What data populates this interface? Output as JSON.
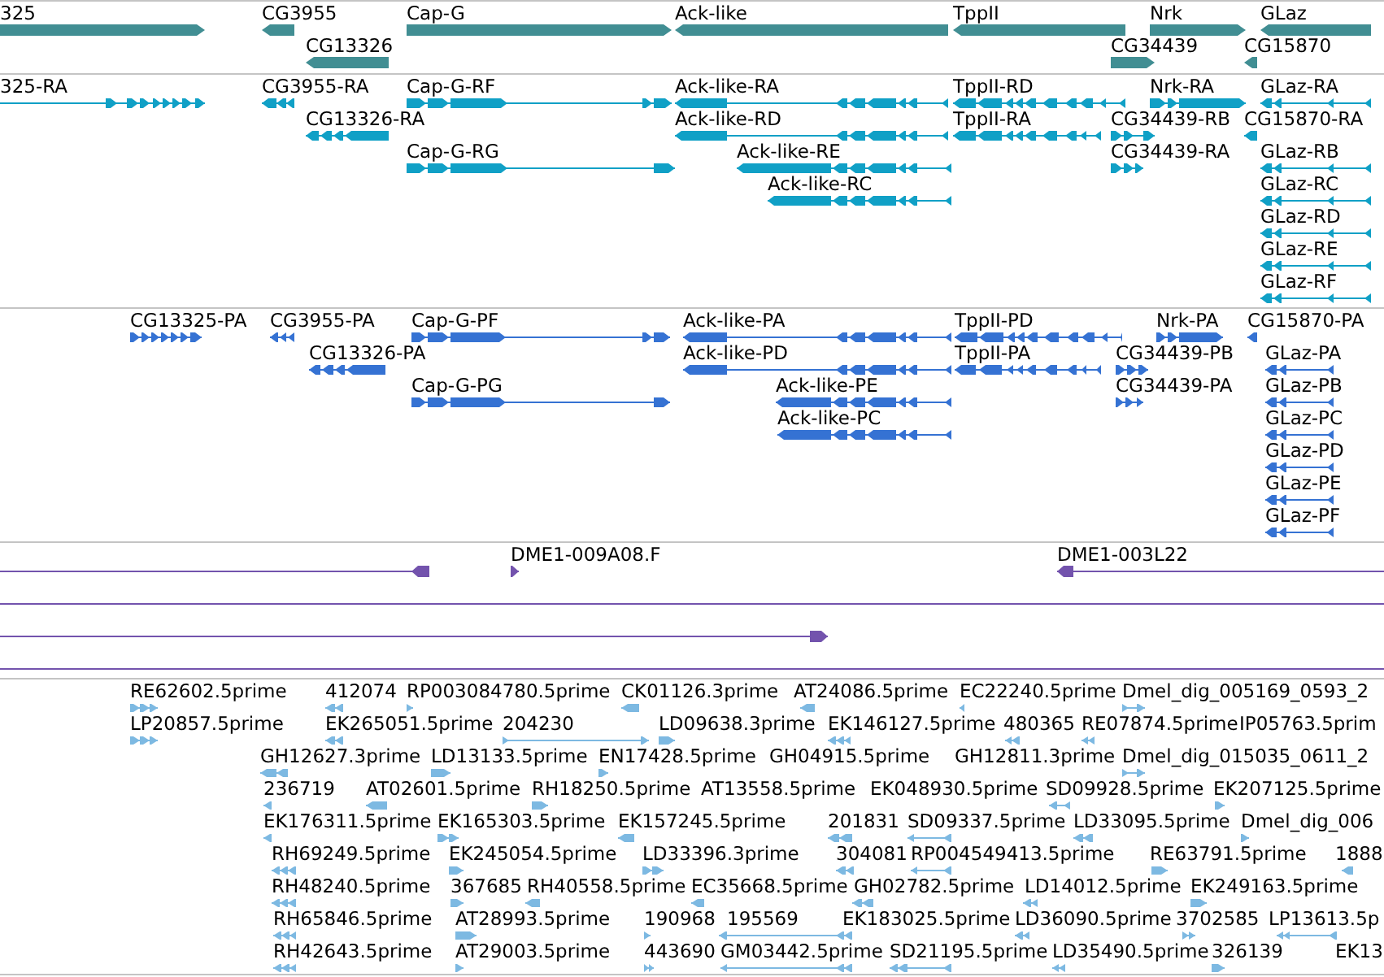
{
  "tracks": [
    {
      "kind": "gene",
      "color": "#418e93",
      "lanes": [
        {
          "features": [
            {
              "label": "325",
              "reverse": false
            },
            {
              "label": "CG3955",
              "reverse": true
            },
            {
              "label": "Cap-G",
              "reverse": false
            },
            {
              "label": "Ack-like",
              "reverse": true
            },
            {
              "label": "TppII",
              "reverse": true
            },
            {
              "label": "Nrk",
              "reverse": false
            },
            {
              "label": "GLaz",
              "reverse": true
            }
          ]
        },
        {
          "features": [
            {
              "label": "CG13326",
              "reverse": true
            },
            {
              "label": "CG34439",
              "reverse": false
            },
            {
              "label": "CG15870",
              "reverse": true
            }
          ]
        }
      ]
    },
    {
      "kind": "transcript",
      "color": "#10a0c6",
      "lanes": [
        {
          "features": [
            {
              "label": "325-RA",
              "reverse": false
            },
            {
              "label": "CG3955-RA",
              "reverse": true
            },
            {
              "label": "Cap-G-RF",
              "reverse": false
            },
            {
              "label": "Ack-like-RA",
              "reverse": true
            },
            {
              "label": "TppII-RD",
              "reverse": true
            },
            {
              "label": "Nrk-RA",
              "reverse": false
            },
            {
              "label": "GLaz-RA",
              "reverse": true
            }
          ]
        },
        {
          "features": [
            {
              "label": "CG13326-RA",
              "reverse": true
            },
            {
              "label": "Ack-like-RD",
              "reverse": true
            },
            {
              "label": "TppII-RA",
              "reverse": true
            },
            {
              "label": "CG34439-RB",
              "reverse": false
            },
            {
              "label": "CG15870-RA",
              "reverse": true
            }
          ]
        },
        {
          "features": [
            {
              "label": "Cap-G-RG",
              "reverse": false
            },
            {
              "label": "Ack-like-RE",
              "reverse": true
            },
            {
              "label": "CG34439-RA",
              "reverse": false
            },
            {
              "label": "GLaz-RB",
              "reverse": true
            }
          ]
        },
        {
          "features": [
            {
              "label": "Ack-like-RC",
              "reverse": true
            },
            {
              "label": "GLaz-RC",
              "reverse": true
            }
          ]
        },
        {
          "features": [
            {
              "label": "GLaz-RD",
              "reverse": true
            }
          ]
        },
        {
          "features": [
            {
              "label": "GLaz-RE",
              "reverse": true
            }
          ]
        },
        {
          "features": [
            {
              "label": "GLaz-RF",
              "reverse": true
            }
          ]
        }
      ]
    },
    {
      "kind": "protein",
      "color": "#3572d3",
      "lanes": [
        {
          "features": [
            {
              "label": "CG13325-PA",
              "reverse": false
            },
            {
              "label": "CG3955-PA",
              "reverse": true
            },
            {
              "label": "Cap-G-PF",
              "reverse": false
            },
            {
              "label": "Ack-like-PA",
              "reverse": true
            },
            {
              "label": "TppII-PD",
              "reverse": true
            },
            {
              "label": "Nrk-PA",
              "reverse": false
            },
            {
              "label": "CG15870-PA",
              "reverse": true
            }
          ]
        },
        {
          "features": [
            {
              "label": "CG13326-PA",
              "reverse": true
            },
            {
              "label": "Ack-like-PD",
              "reverse": true
            },
            {
              "label": "TppII-PA",
              "reverse": true
            },
            {
              "label": "CG34439-PB",
              "reverse": false
            },
            {
              "label": "GLaz-PA",
              "reverse": true
            }
          ]
        },
        {
          "features": [
            {
              "label": "Cap-G-PG",
              "reverse": false
            },
            {
              "label": "Ack-like-PE",
              "reverse": true
            },
            {
              "label": "CG34439-PA",
              "reverse": false
            },
            {
              "label": "GLaz-PB",
              "reverse": true
            }
          ]
        },
        {
          "features": [
            {
              "label": "Ack-like-PC",
              "reverse": true
            },
            {
              "label": "GLaz-PC",
              "reverse": true
            }
          ]
        },
        {
          "features": [
            {
              "label": "GLaz-PD",
              "reverse": true
            }
          ]
        },
        {
          "features": [
            {
              "label": "GLaz-PE",
              "reverse": true
            }
          ]
        },
        {
          "features": [
            {
              "label": "GLaz-PF",
              "reverse": true
            }
          ]
        }
      ]
    },
    {
      "kind": "clone",
      "color": "#7353ad",
      "lanes": [
        {
          "features": [
            {
              "kind": "arrow",
              "reverse": true
            },
            {
              "kind": "arrow",
              "label": "DME1-009A08.F",
              "reverse": false
            },
            {
              "kind": "arrow",
              "label": "DME1-003L22",
              "reverse": true
            }
          ]
        },
        {
          "features": [
            {
              "kind": "line"
            }
          ]
        },
        {
          "features": [
            {
              "kind": "arrow",
              "reverse": false
            }
          ]
        },
        {
          "features": [
            {
              "kind": "line"
            }
          ]
        }
      ]
    },
    {
      "kind": "est",
      "color": "#7db9e2",
      "lanes": [
        {
          "features": [
            {
              "label": "RE62602.5prime",
              "reverse": false
            },
            {
              "label": "412074",
              "reverse": true
            },
            {
              "label": "RP003084780.5prime",
              "reverse": false
            },
            {
              "label": "CK01126.3prime",
              "reverse": true
            },
            {
              "label": "AT24086.5prime",
              "reverse": true
            },
            {
              "label": "EC22240.5prime",
              "reverse": true
            },
            {
              "label": "Dmel_dig_005169_0593_2",
              "reverse": false
            }
          ]
        },
        {
          "features": [
            {
              "label": "LP20857.5prime",
              "reverse": false
            },
            {
              "label": "EK265051.5prime",
              "reverse": true
            },
            {
              "label": "204230",
              "reverse": false
            },
            {
              "label": "LD09638.3prime",
              "reverse": false
            },
            {
              "label": "EK146127.5prime",
              "reverse": true
            },
            {
              "label": "480365",
              "reverse": true
            },
            {
              "label": "RE07874.5prime",
              "reverse": true
            },
            {
              "label": "IP05763.5prim"
            }
          ]
        },
        {
          "features": [
            {
              "label": "GH12627.3prime",
              "reverse": true
            },
            {
              "label": "LD13133.5prime",
              "reverse": false
            },
            {
              "label": "EN17428.5prime",
              "reverse": false
            },
            {
              "label": "GH04915.5prime"
            },
            {
              "label": "GH12811.3prime"
            },
            {
              "label": "Dmel_dig_015035_0611_2",
              "reverse": false
            }
          ]
        },
        {
          "features": [
            {
              "label": "236719",
              "reverse": true
            },
            {
              "label": "AT02601.5prime",
              "reverse": true
            },
            {
              "label": "RH18250.5prime",
              "reverse": false
            },
            {
              "label": "AT13558.5prime"
            },
            {
              "label": "EK048930.5prime"
            },
            {
              "label": "SD09928.5prime",
              "reverse": true
            },
            {
              "label": "EK207125.5prime",
              "reverse": false
            }
          ]
        },
        {
          "features": [
            {
              "label": "EK176311.5prime",
              "reverse": true
            },
            {
              "label": "EK165303.5prime",
              "reverse": false
            },
            {
              "label": "EK157245.5prime",
              "reverse": true
            },
            {
              "label": "201831",
              "reverse": true
            },
            {
              "label": "SD09337.5prime",
              "reverse": true
            },
            {
              "label": "LD33095.5prime",
              "reverse": true
            },
            {
              "label": "Dmel_dig_006",
              "reverse": false
            }
          ]
        },
        {
          "features": [
            {
              "label": "RH69249.5prime",
              "reverse": true
            },
            {
              "label": "EK245054.5prime",
              "reverse": false
            },
            {
              "label": "LD33396.3prime",
              "reverse": false
            },
            {
              "label": "304081",
              "reverse": true
            },
            {
              "label": "RP004549413.5prime",
              "reverse": true
            },
            {
              "label": "RE63791.5prime",
              "reverse": false
            },
            {
              "label": "1888",
              "reverse": true
            }
          ]
        },
        {
          "features": [
            {
              "label": "RH48240.5prime",
              "reverse": true
            },
            {
              "label": "367685",
              "reverse": false
            },
            {
              "label": "RH40558.5prime",
              "reverse": true
            },
            {
              "label": "EC35668.5prime",
              "reverse": true
            },
            {
              "label": "GH02782.5prime",
              "reverse": true
            },
            {
              "label": "LD14012.5prime",
              "reverse": true
            },
            {
              "label": "EK249163.5prime",
              "reverse": false
            }
          ]
        },
        {
          "features": [
            {
              "label": "RH65846.5prime",
              "reverse": true
            },
            {
              "label": "AT28993.5prime",
              "reverse": false
            },
            {
              "label": "190968",
              "reverse": false
            },
            {
              "label": "195569",
              "reverse": true
            },
            {
              "label": "EK183025.5prime"
            },
            {
              "label": "LD36090.5prime",
              "reverse": true
            },
            {
              "label": "3702585",
              "reverse": false
            },
            {
              "label": "LP13613.5p",
              "reverse": true
            }
          ]
        },
        {
          "features": [
            {
              "label": "RH42643.5prime",
              "reverse": true
            },
            {
              "label": "AT29003.5prime",
              "reverse": false
            },
            {
              "label": "443690",
              "reverse": false
            },
            {
              "label": "GM03442.5prime",
              "reverse": true
            },
            {
              "label": "SD21195.5prime",
              "reverse": true
            },
            {
              "label": "LD35490.5prime",
              "reverse": true
            },
            {
              "label": "326139",
              "reverse": false
            },
            {
              "label": "EK13"
            }
          ]
        }
      ]
    }
  ]
}
